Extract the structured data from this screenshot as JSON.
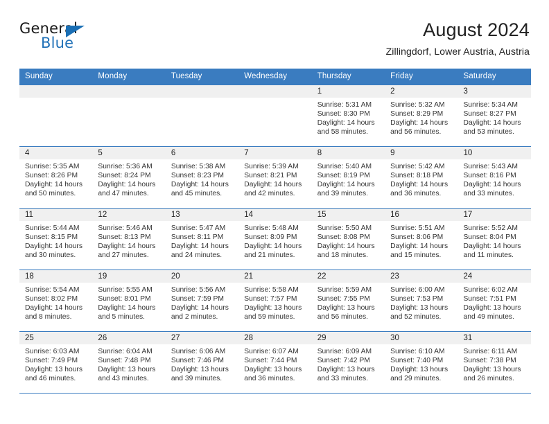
{
  "brand": {
    "name_top": "General",
    "name_bottom": "Blue",
    "triangle_icon": "triangle-logo-icon",
    "color_blue": "#2272b8",
    "color_triangle": "#1a6fb5"
  },
  "header": {
    "title": "August 2024",
    "subtitle": "Zillingdorf, Lower Austria, Austria"
  },
  "theme": {
    "header_bg": "#3a7cc0",
    "header_text": "#ffffff",
    "daynum_bg": "#f0f0f0",
    "cell_text": "#333333"
  },
  "calendar": {
    "weekday_headers": [
      "Sunday",
      "Monday",
      "Tuesday",
      "Wednesday",
      "Thursday",
      "Friday",
      "Saturday"
    ],
    "weeks": [
      [
        {
          "day": "",
          "empty": true,
          "sunrise": "",
          "sunset": "",
          "daylight1": "",
          "daylight2": ""
        },
        {
          "day": "",
          "empty": true,
          "sunrise": "",
          "sunset": "",
          "daylight1": "",
          "daylight2": ""
        },
        {
          "day": "",
          "empty": true,
          "sunrise": "",
          "sunset": "",
          "daylight1": "",
          "daylight2": ""
        },
        {
          "day": "",
          "empty": true,
          "sunrise": "",
          "sunset": "",
          "daylight1": "",
          "daylight2": ""
        },
        {
          "day": "1",
          "empty": false,
          "sunrise": "Sunrise: 5:31 AM",
          "sunset": "Sunset: 8:30 PM",
          "daylight1": "Daylight: 14 hours",
          "daylight2": "and 58 minutes."
        },
        {
          "day": "2",
          "empty": false,
          "sunrise": "Sunrise: 5:32 AM",
          "sunset": "Sunset: 8:29 PM",
          "daylight1": "Daylight: 14 hours",
          "daylight2": "and 56 minutes."
        },
        {
          "day": "3",
          "empty": false,
          "sunrise": "Sunrise: 5:34 AM",
          "sunset": "Sunset: 8:27 PM",
          "daylight1": "Daylight: 14 hours",
          "daylight2": "and 53 minutes."
        }
      ],
      [
        {
          "day": "4",
          "empty": false,
          "sunrise": "Sunrise: 5:35 AM",
          "sunset": "Sunset: 8:26 PM",
          "daylight1": "Daylight: 14 hours",
          "daylight2": "and 50 minutes."
        },
        {
          "day": "5",
          "empty": false,
          "sunrise": "Sunrise: 5:36 AM",
          "sunset": "Sunset: 8:24 PM",
          "daylight1": "Daylight: 14 hours",
          "daylight2": "and 47 minutes."
        },
        {
          "day": "6",
          "empty": false,
          "sunrise": "Sunrise: 5:38 AM",
          "sunset": "Sunset: 8:23 PM",
          "daylight1": "Daylight: 14 hours",
          "daylight2": "and 45 minutes."
        },
        {
          "day": "7",
          "empty": false,
          "sunrise": "Sunrise: 5:39 AM",
          "sunset": "Sunset: 8:21 PM",
          "daylight1": "Daylight: 14 hours",
          "daylight2": "and 42 minutes."
        },
        {
          "day": "8",
          "empty": false,
          "sunrise": "Sunrise: 5:40 AM",
          "sunset": "Sunset: 8:19 PM",
          "daylight1": "Daylight: 14 hours",
          "daylight2": "and 39 minutes."
        },
        {
          "day": "9",
          "empty": false,
          "sunrise": "Sunrise: 5:42 AM",
          "sunset": "Sunset: 8:18 PM",
          "daylight1": "Daylight: 14 hours",
          "daylight2": "and 36 minutes."
        },
        {
          "day": "10",
          "empty": false,
          "sunrise": "Sunrise: 5:43 AM",
          "sunset": "Sunset: 8:16 PM",
          "daylight1": "Daylight: 14 hours",
          "daylight2": "and 33 minutes."
        }
      ],
      [
        {
          "day": "11",
          "empty": false,
          "sunrise": "Sunrise: 5:44 AM",
          "sunset": "Sunset: 8:15 PM",
          "daylight1": "Daylight: 14 hours",
          "daylight2": "and 30 minutes."
        },
        {
          "day": "12",
          "empty": false,
          "sunrise": "Sunrise: 5:46 AM",
          "sunset": "Sunset: 8:13 PM",
          "daylight1": "Daylight: 14 hours",
          "daylight2": "and 27 minutes."
        },
        {
          "day": "13",
          "empty": false,
          "sunrise": "Sunrise: 5:47 AM",
          "sunset": "Sunset: 8:11 PM",
          "daylight1": "Daylight: 14 hours",
          "daylight2": "and 24 minutes."
        },
        {
          "day": "14",
          "empty": false,
          "sunrise": "Sunrise: 5:48 AM",
          "sunset": "Sunset: 8:09 PM",
          "daylight1": "Daylight: 14 hours",
          "daylight2": "and 21 minutes."
        },
        {
          "day": "15",
          "empty": false,
          "sunrise": "Sunrise: 5:50 AM",
          "sunset": "Sunset: 8:08 PM",
          "daylight1": "Daylight: 14 hours",
          "daylight2": "and 18 minutes."
        },
        {
          "day": "16",
          "empty": false,
          "sunrise": "Sunrise: 5:51 AM",
          "sunset": "Sunset: 8:06 PM",
          "daylight1": "Daylight: 14 hours",
          "daylight2": "and 15 minutes."
        },
        {
          "day": "17",
          "empty": false,
          "sunrise": "Sunrise: 5:52 AM",
          "sunset": "Sunset: 8:04 PM",
          "daylight1": "Daylight: 14 hours",
          "daylight2": "and 11 minutes."
        }
      ],
      [
        {
          "day": "18",
          "empty": false,
          "sunrise": "Sunrise: 5:54 AM",
          "sunset": "Sunset: 8:02 PM",
          "daylight1": "Daylight: 14 hours",
          "daylight2": "and 8 minutes."
        },
        {
          "day": "19",
          "empty": false,
          "sunrise": "Sunrise: 5:55 AM",
          "sunset": "Sunset: 8:01 PM",
          "daylight1": "Daylight: 14 hours",
          "daylight2": "and 5 minutes."
        },
        {
          "day": "20",
          "empty": false,
          "sunrise": "Sunrise: 5:56 AM",
          "sunset": "Sunset: 7:59 PM",
          "daylight1": "Daylight: 14 hours",
          "daylight2": "and 2 minutes."
        },
        {
          "day": "21",
          "empty": false,
          "sunrise": "Sunrise: 5:58 AM",
          "sunset": "Sunset: 7:57 PM",
          "daylight1": "Daylight: 13 hours",
          "daylight2": "and 59 minutes."
        },
        {
          "day": "22",
          "empty": false,
          "sunrise": "Sunrise: 5:59 AM",
          "sunset": "Sunset: 7:55 PM",
          "daylight1": "Daylight: 13 hours",
          "daylight2": "and 56 minutes."
        },
        {
          "day": "23",
          "empty": false,
          "sunrise": "Sunrise: 6:00 AM",
          "sunset": "Sunset: 7:53 PM",
          "daylight1": "Daylight: 13 hours",
          "daylight2": "and 52 minutes."
        },
        {
          "day": "24",
          "empty": false,
          "sunrise": "Sunrise: 6:02 AM",
          "sunset": "Sunset: 7:51 PM",
          "daylight1": "Daylight: 13 hours",
          "daylight2": "and 49 minutes."
        }
      ],
      [
        {
          "day": "25",
          "empty": false,
          "sunrise": "Sunrise: 6:03 AM",
          "sunset": "Sunset: 7:49 PM",
          "daylight1": "Daylight: 13 hours",
          "daylight2": "and 46 minutes."
        },
        {
          "day": "26",
          "empty": false,
          "sunrise": "Sunrise: 6:04 AM",
          "sunset": "Sunset: 7:48 PM",
          "daylight1": "Daylight: 13 hours",
          "daylight2": "and 43 minutes."
        },
        {
          "day": "27",
          "empty": false,
          "sunrise": "Sunrise: 6:06 AM",
          "sunset": "Sunset: 7:46 PM",
          "daylight1": "Daylight: 13 hours",
          "daylight2": "and 39 minutes."
        },
        {
          "day": "28",
          "empty": false,
          "sunrise": "Sunrise: 6:07 AM",
          "sunset": "Sunset: 7:44 PM",
          "daylight1": "Daylight: 13 hours",
          "daylight2": "and 36 minutes."
        },
        {
          "day": "29",
          "empty": false,
          "sunrise": "Sunrise: 6:09 AM",
          "sunset": "Sunset: 7:42 PM",
          "daylight1": "Daylight: 13 hours",
          "daylight2": "and 33 minutes."
        },
        {
          "day": "30",
          "empty": false,
          "sunrise": "Sunrise: 6:10 AM",
          "sunset": "Sunset: 7:40 PM",
          "daylight1": "Daylight: 13 hours",
          "daylight2": "and 29 minutes."
        },
        {
          "day": "31",
          "empty": false,
          "sunrise": "Sunrise: 6:11 AM",
          "sunset": "Sunset: 7:38 PM",
          "daylight1": "Daylight: 13 hours",
          "daylight2": "and 26 minutes."
        }
      ]
    ]
  }
}
